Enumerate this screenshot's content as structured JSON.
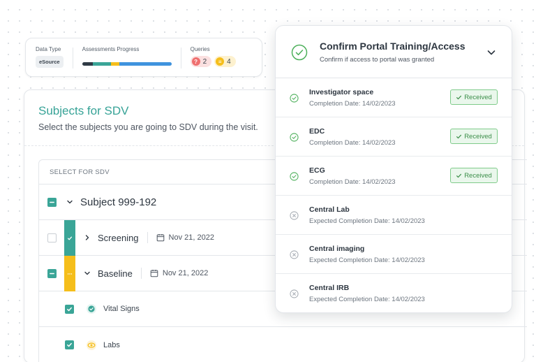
{
  "infobar": {
    "data_type_label": "Data Type",
    "data_type_value": "eSource",
    "progress_label": "Assessments Progress",
    "progress_segments": [
      {
        "color": "#2f3a45",
        "fraction": 0.12
      },
      {
        "color": "#3aa597",
        "fraction": 0.2
      },
      {
        "color": "#f5be1b",
        "fraction": 0.1
      },
      {
        "color": "#3f93de",
        "fraction": 0.58
      }
    ],
    "queries_label": "Queries",
    "queries": [
      {
        "icon": "question-icon",
        "glyph": "?",
        "count": "2",
        "color": "#ef6f6f"
      },
      {
        "icon": "comment-icon",
        "glyph": "≡",
        "count": "4",
        "color": "#f5be1b"
      }
    ]
  },
  "sdv": {
    "title": "Subjects for SDV",
    "subtitle": "Select the subjects you are going to SDV during the visit.",
    "column_header": "SELECT FOR SDV",
    "subject": {
      "name": "Subject 999-192",
      "checked": true
    },
    "visits": [
      {
        "name": "Screening",
        "date": "Nov 21, 2022",
        "checked": false,
        "status_color": "#3aa597",
        "status_icon": "check-icon",
        "expanded": false
      },
      {
        "name": "Baseline",
        "date": "Nov 21, 2022",
        "checked": true,
        "status_color": "#f5be1b",
        "status_icon": "ellipsis-icon",
        "expanded": true
      }
    ],
    "forms": [
      {
        "name": "Vital Signs",
        "checked": true,
        "icon": "check-circle-icon",
        "icon_color": "#3aa597"
      },
      {
        "name": "Labs",
        "checked": true,
        "icon": "eye-icon",
        "icon_color": "#f5be1b"
      }
    ]
  },
  "portal": {
    "title": "Confirm Portal Training/Access",
    "subtitle": "Confirm if access to portal was granted",
    "items": [
      {
        "title": "Investigator space",
        "date": "Completion Date: 14/02/2023",
        "status": "done",
        "badge": "Received"
      },
      {
        "title": "EDC",
        "date": "Completion Date: 14/02/2023",
        "status": "done",
        "badge": "Received"
      },
      {
        "title": "ECG",
        "date": "Completion Date: 14/02/2023",
        "status": "done",
        "badge": "Received"
      },
      {
        "title": "Central Lab",
        "date": "Expected Completion Date: 14/02/2023",
        "status": "pending",
        "badge": ""
      },
      {
        "title": "Central imaging",
        "date": "Expected Completion Date: 14/02/2023",
        "status": "pending",
        "badge": ""
      },
      {
        "title": "Central IRB",
        "date": "Expected Completion Date: 14/02/2023",
        "status": "pending",
        "badge": ""
      }
    ]
  },
  "colors": {
    "accent_teal": "#3aa597",
    "success_green": "#3b8e49",
    "warning_yellow": "#f5be1b",
    "error_red": "#ef6f6f"
  }
}
